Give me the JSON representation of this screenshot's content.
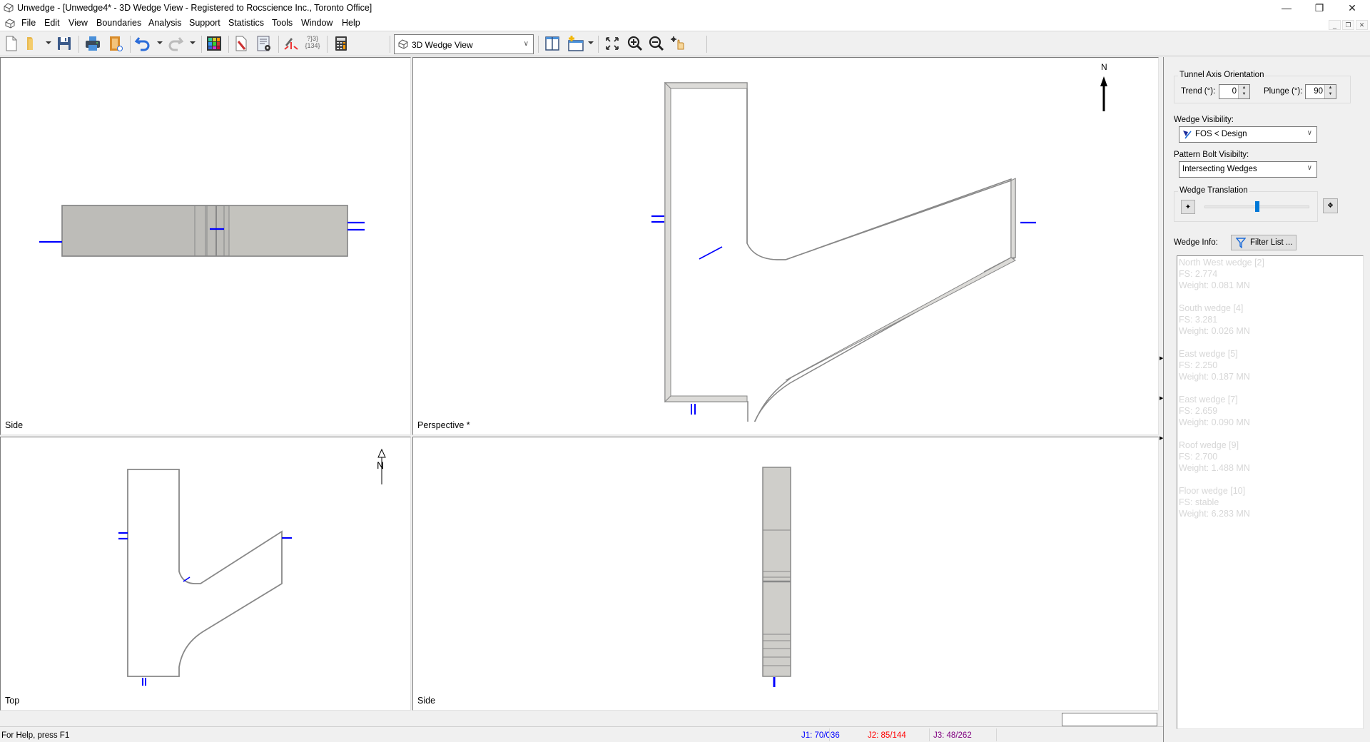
{
  "window": {
    "title": "Unwedge - [Unwedge4* - 3D Wedge View - Registered to Rocscience Inc., Toronto Office]",
    "controls": {
      "minimize": "—",
      "restore": "❐",
      "close": "✕"
    },
    "mdi_controls": {
      "minimize": "_",
      "restore": "❐",
      "close": "✕"
    }
  },
  "menu": [
    "File",
    "Edit",
    "View",
    "Boundaries",
    "Analysis",
    "Support",
    "Statistics",
    "Tools",
    "Window",
    "Help"
  ],
  "toolbar": {
    "buttons": [
      "new-file",
      "open-folder",
      "save",
      "print",
      "print-preview",
      "undo",
      "redo",
      "colors-palette",
      "edit-boundary",
      "settings-doc",
      "joint-combinations",
      "joint-set-combos",
      "calculator",
      "tile-views",
      "add-view",
      "zoom-extents",
      "zoom-in",
      "zoom-out",
      "pan"
    ],
    "view_select": "3D Wedge View",
    "joint_combos_text": "{134}"
  },
  "viewports": {
    "top_left": {
      "label": "Side"
    },
    "perspective": {
      "label": "Perspective *",
      "north_label": "N"
    },
    "bottom_left": {
      "label": "Top",
      "north_label": "N"
    },
    "bottom_right": {
      "label": "Side"
    }
  },
  "side_panel": {
    "tunnel_axis": {
      "title": "Tunnel Axis Orientation",
      "trend_label": "Trend (°):",
      "trend_value": "0",
      "plunge_label": "Plunge (°):",
      "plunge_value": "90"
    },
    "wedge_visibility": {
      "label": "Wedge Visibility:",
      "value": "FOS < Design"
    },
    "pattern_bolt_visibility": {
      "label": "Pattern Bolt Visibilty:",
      "value": "Intersecting Wedges"
    },
    "wedge_translation": {
      "title": "Wedge Translation",
      "slider_fraction": 0.5
    },
    "wedge_info": {
      "label": "Wedge Info:",
      "filter_button": "Filter List ...",
      "entries": [
        {
          "name": "North West wedge [2]",
          "fs": "FS: 2.774",
          "weight": "Weight: 0.081 MN"
        },
        {
          "name": "South wedge [4]",
          "fs": "FS: 3.281",
          "weight": "Weight: 0.026 MN"
        },
        {
          "name": "East wedge [5]",
          "fs": "FS: 2.250",
          "weight": "Weight: 0.187 MN"
        },
        {
          "name": "East wedge [7]",
          "fs": "FS: 2.659",
          "weight": "Weight: 0.090 MN"
        },
        {
          "name": "Roof wedge [9]",
          "fs": "FS: 2.700",
          "weight": "Weight: 1.488 MN"
        },
        {
          "name": "Floor wedge [10]",
          "fs": "FS: stable",
          "weight": "Weight: 6.283 MN"
        }
      ]
    }
  },
  "status_bar": {
    "help": "For Help, press F1",
    "j1": {
      "text": "J1: 70/036",
      "color": "#0000ff"
    },
    "j2": {
      "text": "J2: 85/144",
      "color": "#ff0000"
    },
    "j3": {
      "text": "J3: 48/262",
      "color": "#800080"
    }
  },
  "colors": {
    "bolt_blue": "#0000ff",
    "excavation_gray": "#888888",
    "wedge_fill": "#c2c0bc"
  }
}
